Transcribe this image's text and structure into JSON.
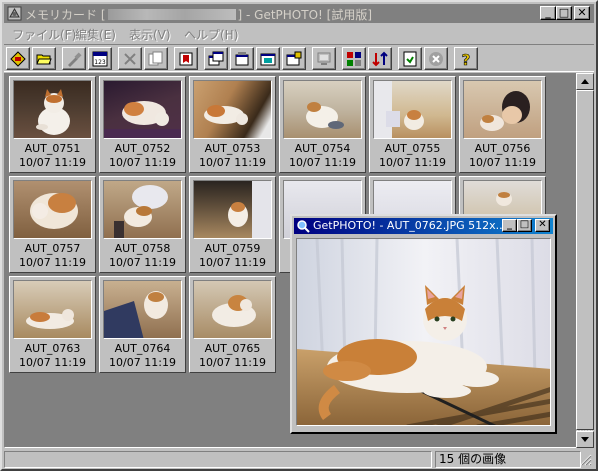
{
  "window": {
    "title_prefix": "メモリカード [",
    "title_suffix": "] - GetPHOTO! [試用版]"
  },
  "menu": [
    "ファイル(F)",
    "編集(E)",
    "表示(V)",
    "ヘルプ(H)"
  ],
  "toolbar_icons": [
    "card-icon",
    "open-folder-icon",
    "brush-icon",
    "calendar-icon",
    "delete-x-icon",
    "copy-icon",
    "bookmark-icon",
    "window-icon-1",
    "window-icon-2",
    "window-icon-3",
    "window-icon-4",
    "monitor-icon",
    "rotate-grid-icon",
    "sort-icon",
    "save-icon",
    "cancel-icon",
    "help-icon"
  ],
  "thumbnails": [
    {
      "name": "AUT_0751",
      "date": "10/07 11:19"
    },
    {
      "name": "AUT_0752",
      "date": "10/07 11:19"
    },
    {
      "name": "AUT_0753",
      "date": "10/07 11:19"
    },
    {
      "name": "AUT_0754",
      "date": "10/07 11:19"
    },
    {
      "name": "AUT_0755",
      "date": "10/07 11:19"
    },
    {
      "name": "AUT_0756",
      "date": "10/07 11:19"
    },
    {
      "name": "AUT_0757",
      "date": "10/07 11:19"
    },
    {
      "name": "AUT_0758",
      "date": "10/07 11:19"
    },
    {
      "name": "AUT_0759",
      "date": "10/07 11:19"
    },
    {
      "name": "AUT_0763",
      "date": "10/07 11:19"
    },
    {
      "name": "AUT_0764",
      "date": "10/07 11:19"
    },
    {
      "name": "AUT_0765",
      "date": "10/07 11:19"
    }
  ],
  "status": {
    "count_text": "15 個の画像"
  },
  "preview": {
    "title": "GetPHOTO! - AUT_0762.JPG  512x..."
  },
  "caption_buttons": {
    "minimize": "_",
    "maximize": "□",
    "close": "✕"
  },
  "colors": {
    "active_title": "#000080",
    "inactive_title": "#808080",
    "face": "#c0c0c0"
  }
}
